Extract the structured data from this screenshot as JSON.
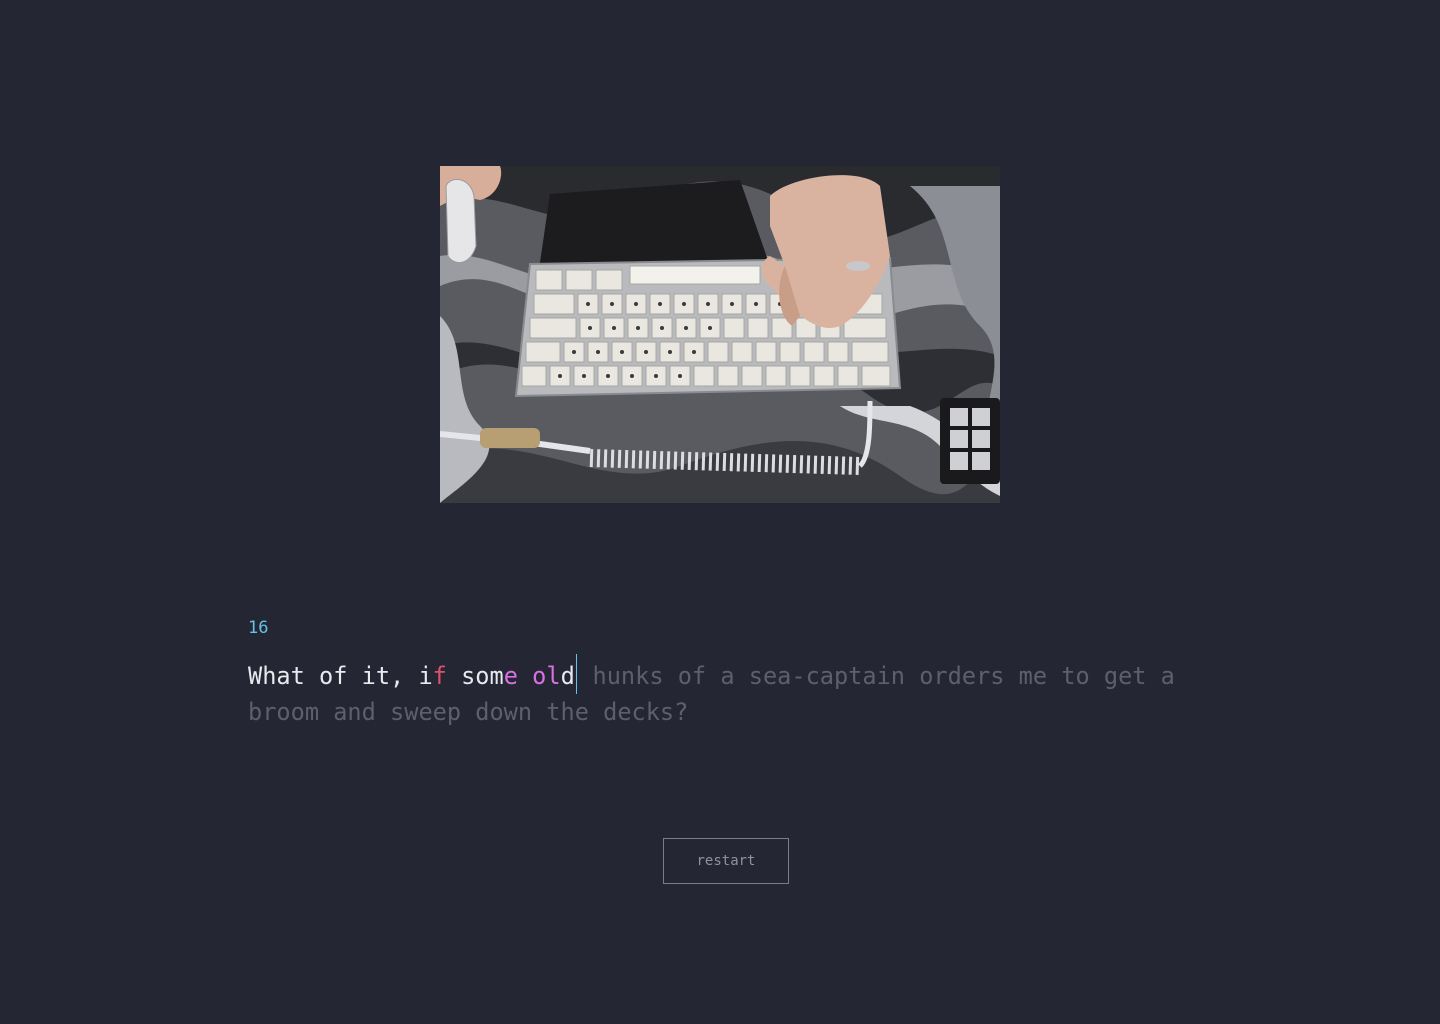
{
  "counter": "16",
  "passage": {
    "typed": [
      {
        "text": "What of it, i",
        "state": "correct"
      },
      {
        "text": "f",
        "state": "incorrect"
      },
      {
        "text": " som",
        "state": "correct"
      },
      {
        "text": "e",
        "state": "extra"
      },
      {
        "text": " ",
        "state": "correct"
      },
      {
        "text": "ol",
        "state": "extra"
      },
      {
        "text": "d",
        "state": "correct"
      }
    ],
    "remaining": " hunks of a sea-captain orders me to get a broom and sweep down the decks?"
  },
  "restart_label": "restart",
  "colors": {
    "background": "#242733",
    "accent": "#64c3e6",
    "correct": "#e8e8ee",
    "incorrect": "#e0506a",
    "extra": "#d970e3",
    "pending": "#5d606c"
  }
}
